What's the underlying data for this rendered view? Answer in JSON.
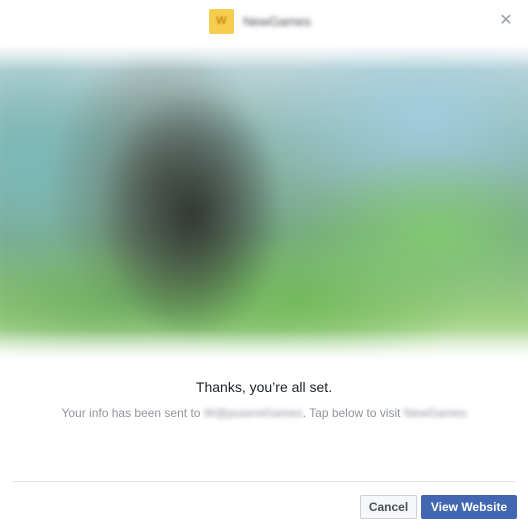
{
  "header": {
    "app_logo_glyph": "W",
    "app_name": "NewGames",
    "close_glyph": "✕"
  },
  "hero": {
    "image": "blurred-landscape-banner"
  },
  "content": {
    "headline": "Thanks, you’re all set.",
    "info_prefix": "Your info has been sent to ",
    "recipient": "W@pusereGames",
    "info_middle": ". Tap below to visit ",
    "site_name": "NewGames"
  },
  "footer": {
    "cancel_label": "Cancel",
    "view_website_label": "View Website"
  },
  "colors": {
    "primary": "#4267b2",
    "logo_bg": "#f6cd4c",
    "subtext": "#90949c",
    "divider": "#e5e5e5"
  }
}
